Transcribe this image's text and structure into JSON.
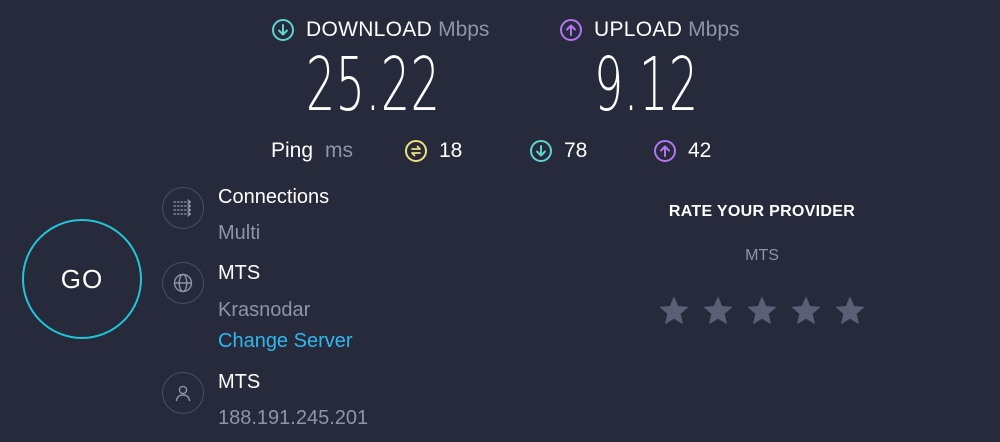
{
  "download": {
    "label": "DOWNLOAD",
    "unit": "Mbps",
    "value": "25.22",
    "icon": "download-arrow-icon",
    "color": "#5ed3cf"
  },
  "upload": {
    "label": "UPLOAD",
    "unit": "Mbps",
    "value": "9.12",
    "icon": "upload-arrow-icon",
    "color": "#b475f2"
  },
  "ping": {
    "label": "Ping",
    "unit": "ms",
    "idle": "18",
    "download": "78",
    "upload": "42",
    "idle_color": "#ece07a"
  },
  "go_button": {
    "label": "GO",
    "color": "#20c6d8"
  },
  "connections": {
    "title": "Connections",
    "value": "Multi",
    "icon": "connections-icon"
  },
  "server": {
    "title": "MTS",
    "location": "Krasnodar",
    "change_label": "Change Server",
    "icon": "globe-icon"
  },
  "client": {
    "title": "MTS",
    "ip": "188.191.245.201",
    "icon": "user-icon"
  },
  "rating": {
    "title": "RATE YOUR PROVIDER",
    "provider": "MTS",
    "star_count": 5,
    "rating": 0
  }
}
